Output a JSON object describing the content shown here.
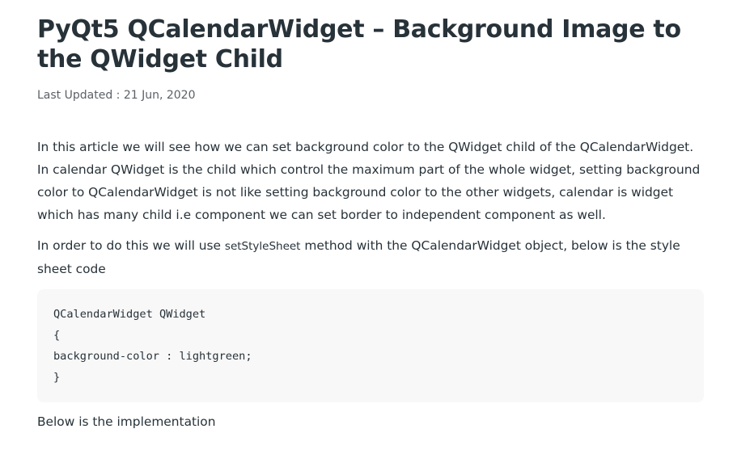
{
  "article": {
    "title": "PyQt5 QCalendarWidget – Background Image to the QWidget Child",
    "last_updated_label": "Last Updated : ",
    "last_updated_date": "21 Jun, 2020",
    "paragraph1": "In this article we will see how we can set background color to the QWidget child of the QCalendarWidget. In calendar QWidget is the child which control the maximum part of the whole widget, setting background color to QCalendarWidget is not like setting background color to the other widgets, calendar is widget which has many child i.e component we can set border to independent component as well.",
    "paragraph2_before": "In order to do this we will use ",
    "paragraph2_code": "setStyleSheet",
    "paragraph2_after": " method with the QCalendarWidget object, below is the style sheet code",
    "code_lines": [
      "QCalendarWidget QWidget",
      "{",
      "background-color : lightgreen;",
      "}"
    ],
    "paragraph3": "Below is the implementation"
  }
}
